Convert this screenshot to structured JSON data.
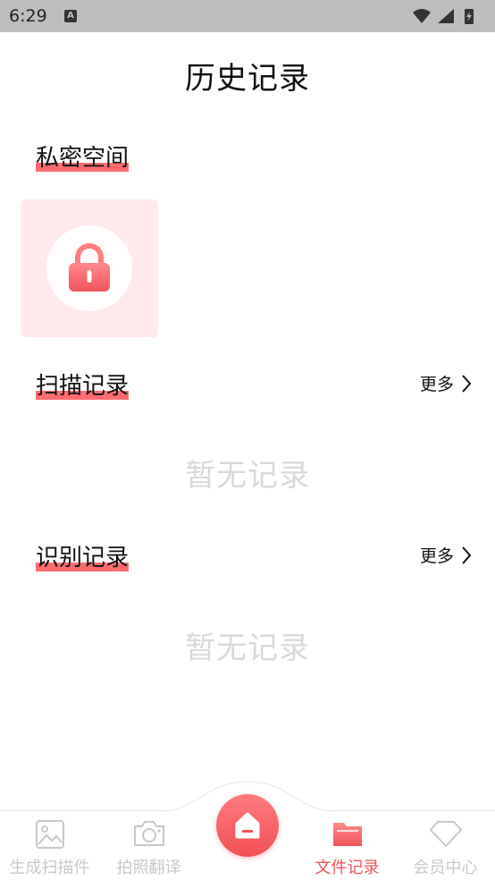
{
  "status_bar": {
    "time": "6:29",
    "notif_letter": "A"
  },
  "header": {
    "title": "历史记录"
  },
  "private_section": {
    "label": "私密空间",
    "icon": "lock-icon",
    "accent": "#ff6c70"
  },
  "scan_section": {
    "label": "扫描记录",
    "more": "更多",
    "empty": "暂无记录"
  },
  "recognize_section": {
    "label": "识别记录",
    "more": "更多",
    "empty": "暂无记录"
  },
  "tabbar": {
    "items": [
      {
        "label": "生成扫描件",
        "icon": "image-icon",
        "active": false
      },
      {
        "label": "拍照翻译",
        "icon": "camera-icon",
        "active": false
      },
      {
        "label": "",
        "icon": "home-icon",
        "active": false
      },
      {
        "label": "文件记录",
        "icon": "folder-icon",
        "active": true
      },
      {
        "label": "会员中心",
        "icon": "diamond-icon",
        "active": false
      }
    ],
    "active_color": "#f0545a",
    "inactive_color": "#c8c8c8"
  }
}
